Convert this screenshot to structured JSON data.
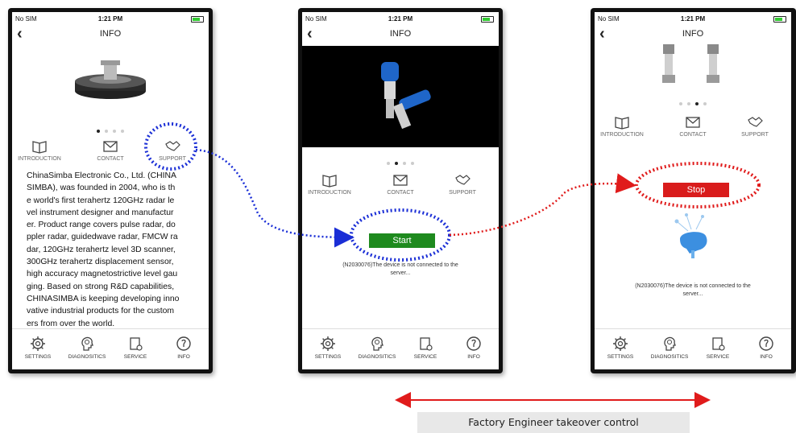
{
  "status_bar": {
    "carrier": "No SIM",
    "time": "1:21 PM"
  },
  "nav": {
    "title": "INFO"
  },
  "tabs": {
    "introduction": "INTRODUCTION",
    "contact": "CONTACT",
    "support": "SUPPORT"
  },
  "bottom_nav": {
    "settings": "SETTINGS",
    "diagnostics": "DIAGNOSITICS",
    "service": "SERVICE",
    "info": "INFO"
  },
  "phone1": {
    "carousel_page": 1,
    "intro_lines": [
      "ChinaSimba Electronic Co., Ltd. (CHINA",
      "SIMBA), was founded in 2004, who is th",
      "e world's first terahertz 120GHz radar le",
      "vel instrument designer and manufactur",
      "er. Product range covers pulse radar, do",
      "ppler radar, guidedwave radar, FMCW ra",
      "dar, 120GHz terahertz level 3D scanner,",
      "300GHz terahertz displacement sensor,",
      "high accuracy magnetostrictive level gau",
      "ging. Based on strong R&D capabilities,",
      "CHINASIMBA is keeping developing inno",
      "vative industrial products for the custom",
      "ers from over the world."
    ]
  },
  "phone2": {
    "carousel_page": 2,
    "start_label": "Start",
    "status_line1": "(N2030076)The device is not connected to the",
    "status_line2": "server..."
  },
  "phone3": {
    "carousel_page": 3,
    "stop_label": "Stop",
    "status_line1": "(N2030076)The device is not connected to the",
    "status_line2": "server..."
  },
  "caption": "Factory Engineer takeover control",
  "colors": {
    "start": "#1e8a1e",
    "stop": "#d91c1c",
    "blue_highlight": "#1a2ed6",
    "red_highlight": "#e01b1b",
    "arrow": "#e01b1b"
  }
}
